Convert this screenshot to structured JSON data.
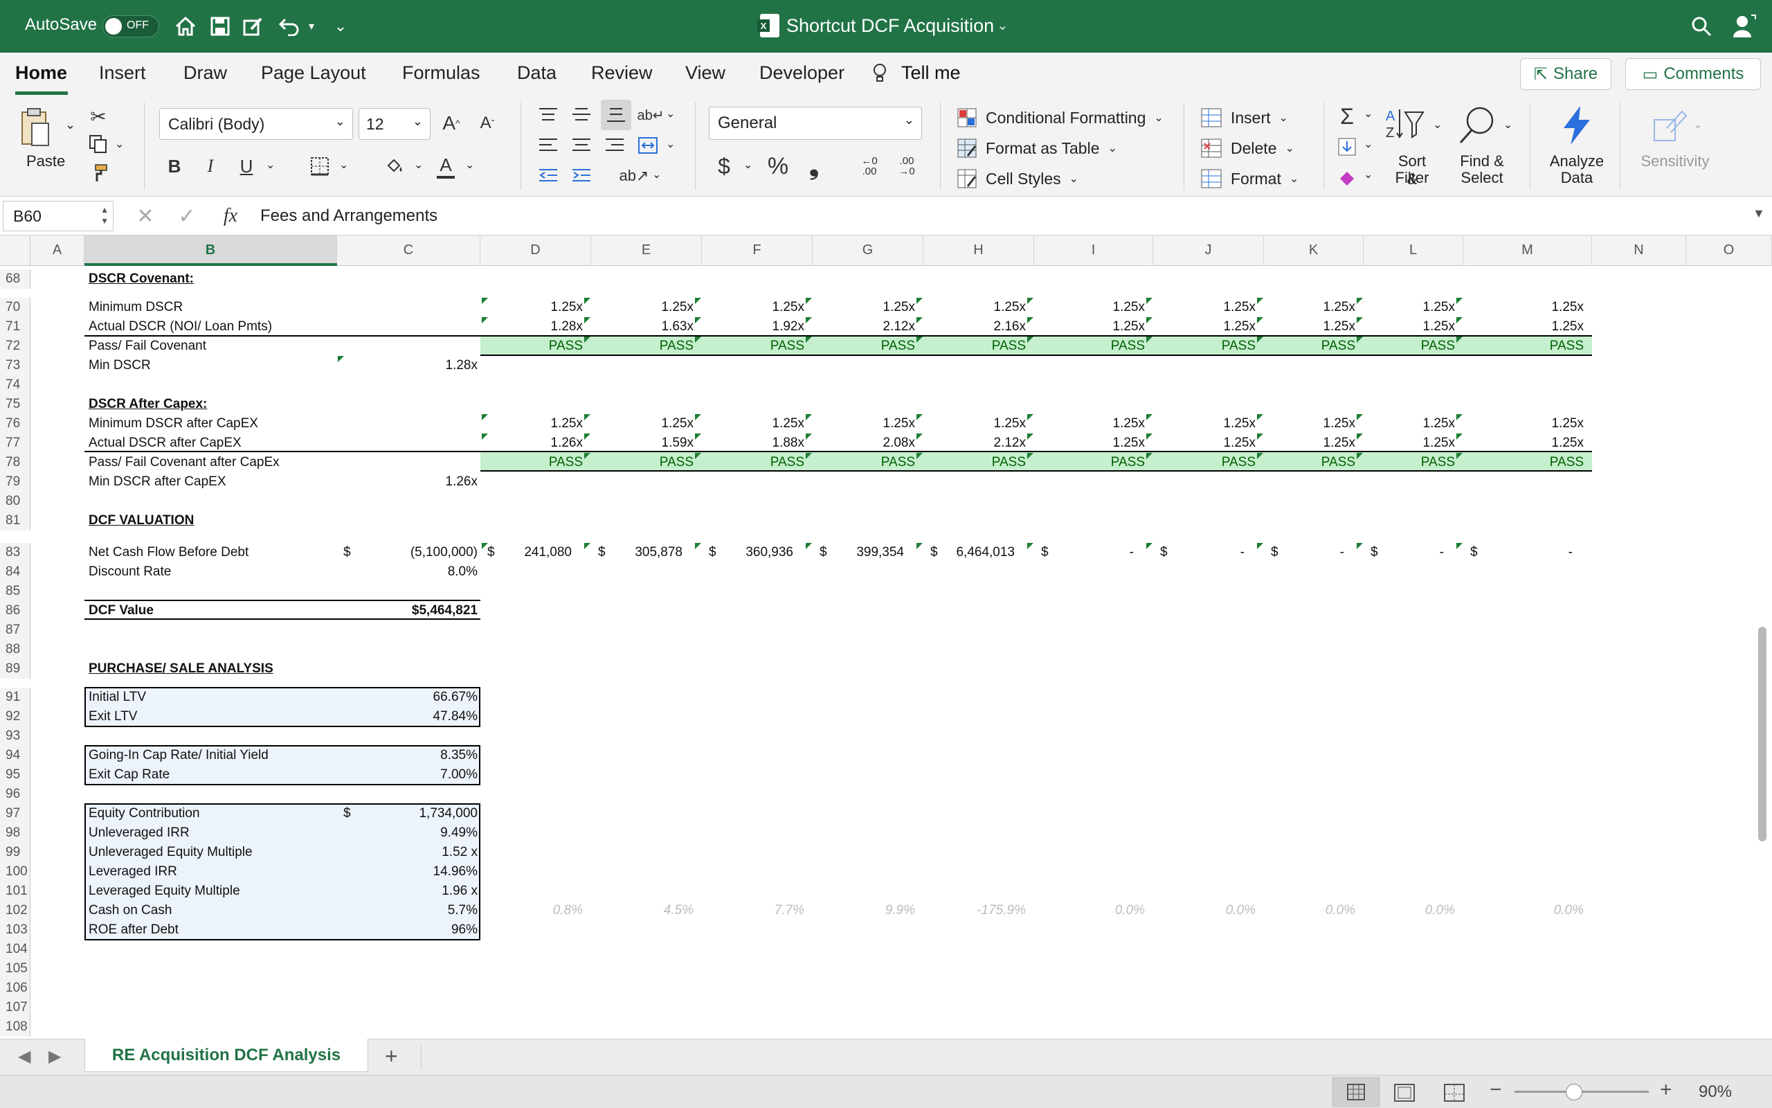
{
  "titlebar": {
    "autosave": "AutoSave",
    "toggle": "OFF",
    "title": "Shortcut DCF Acquisition"
  },
  "tabs": [
    "Home",
    "Insert",
    "Draw",
    "Page Layout",
    "Formulas",
    "Data",
    "Review",
    "View",
    "Developer"
  ],
  "tell_me": "Tell me",
  "share": "Share",
  "comments": "Comments",
  "ribbon": {
    "paste": "Paste",
    "font_name": "Calibri (Body)",
    "font_size": "12",
    "number_format": "General",
    "cond_format": "Conditional Formatting",
    "format_table": "Format as Table",
    "cell_styles": "Cell Styles",
    "insert": "Insert",
    "delete": "Delete",
    "format": "Format",
    "sort_filter_1": "Sort &",
    "sort_filter_2": "Filter",
    "find_select_1": "Find &",
    "find_select_2": "Select",
    "analyze_1": "Analyze",
    "analyze_2": "Data",
    "sensitivity": "Sensitivity"
  },
  "formula_bar": {
    "name_box": "B60",
    "fx": "fx",
    "formula": "Fees and Arrangements"
  },
  "columns": [
    "A",
    "B",
    "C",
    "D",
    "E",
    "F",
    "G",
    "H",
    "I",
    "J",
    "K",
    "L",
    "M",
    "N",
    "O"
  ],
  "rows": [
    "68",
    "70",
    "71",
    "72",
    "73",
    "74",
    "75",
    "76",
    "77",
    "78",
    "79",
    "80",
    "81",
    "83",
    "84",
    "85",
    "86",
    "87",
    "88",
    "89",
    "91",
    "92",
    "93",
    "94",
    "95",
    "96",
    "97",
    "98",
    "99",
    "100",
    "101",
    "102",
    "103",
    "104",
    "105",
    "106",
    "107",
    "108"
  ],
  "labels": {
    "dscr_cov": "DSCR Covenant:",
    "min_dscr": "Minimum DSCR",
    "actual_dscr": "Actual DSCR (NOI/ Loan Pmts)",
    "pass_fail": "Pass/ Fail Covenant",
    "min_dscr2": "Min DSCR",
    "dscr_capex": "DSCR After Capex:",
    "min_dscr_capex": "Minimum DSCR after CapEX",
    "actual_dscr_capex": "Actual DSCR after CapEX",
    "pass_fail_capex": "Pass/ Fail Covenant after CapEx",
    "min_dscr_capex2": "Min DSCR after CapEX",
    "dcf_val": "DCF VALUATION",
    "ncf": "Net Cash Flow Before Debt",
    "discount": "Discount Rate",
    "dcf_value": "DCF Value",
    "psa": "PURCHASE/ SALE ANALYSIS",
    "init_ltv": "Initial LTV",
    "exit_ltv": "Exit LTV",
    "going_in": "Going-In Cap Rate/ Initial Yield",
    "exit_cap": "Exit Cap Rate",
    "equity": "Equity Contribution",
    "unlev_irr": "Unleveraged IRR",
    "unlev_mult": "Unleveraged Equity Multiple",
    "lev_irr": "Leveraged IRR",
    "lev_mult": "Leveraged Equity Multiple",
    "coc": "Cash on Cash",
    "roe": "ROE after Debt"
  },
  "values": {
    "min_dscr_c": "1.28x",
    "min_dscr_capex_c": "1.26x",
    "ncf_dollar": "$",
    "ncf_c": "(5,100,000)",
    "discount_c": "8.0%",
    "dcf_value_c": "$5,464,821",
    "init_ltv_c": "66.67%",
    "exit_ltv_c": "47.84%",
    "going_in_c": "8.35%",
    "exit_cap_c": "7.00%",
    "equity_dollar": "$",
    "equity_c": "1,734,000",
    "unlev_irr_c": "9.49%",
    "unlev_mult_c": "1.52 x",
    "lev_irr_c": "14.96%",
    "lev_mult_c": "1.96 x",
    "coc_c": "5.7%",
    "roe_c": "96%"
  },
  "series": {
    "min_dscr": [
      "1.25x",
      "1.25x",
      "1.25x",
      "1.25x",
      "1.25x",
      "1.25x",
      "1.25x",
      "1.25x",
      "1.25x",
      "1.25x"
    ],
    "actual_dscr": [
      "1.28x",
      "1.63x",
      "1.92x",
      "2.12x",
      "2.16x",
      "1.25x",
      "1.25x",
      "1.25x",
      "1.25x",
      "1.25x"
    ],
    "pass": [
      "PASS",
      "PASS",
      "PASS",
      "PASS",
      "PASS",
      "PASS",
      "PASS",
      "PASS",
      "PASS",
      "PASS"
    ],
    "min_dscr_capex": [
      "1.25x",
      "1.25x",
      "1.25x",
      "1.25x",
      "1.25x",
      "1.25x",
      "1.25x",
      "1.25x",
      "1.25x",
      "1.25x"
    ],
    "actual_dscr_capex": [
      "1.26x",
      "1.59x",
      "1.88x",
      "2.08x",
      "2.12x",
      "1.25x",
      "1.25x",
      "1.25x",
      "1.25x",
      "1.25x"
    ],
    "pass_capex": [
      "PASS",
      "PASS",
      "PASS",
      "PASS",
      "PASS",
      "PASS",
      "PASS",
      "PASS",
      "PASS",
      "PASS"
    ],
    "ncf": [
      "241,080",
      "305,878",
      "360,936",
      "399,354",
      "6,464,013",
      "-",
      "-",
      "-",
      "-",
      "-"
    ],
    "coc": [
      "0.8%",
      "4.5%",
      "7.7%",
      "9.9%",
      "-175.9%",
      "0.0%",
      "0.0%",
      "0.0%",
      "0.0%",
      "0.0%"
    ]
  },
  "dollar_sign": "$",
  "sheet_tab": "RE Acquisition DCF Analysis",
  "add_sheet": "+",
  "zoom": "90%"
}
